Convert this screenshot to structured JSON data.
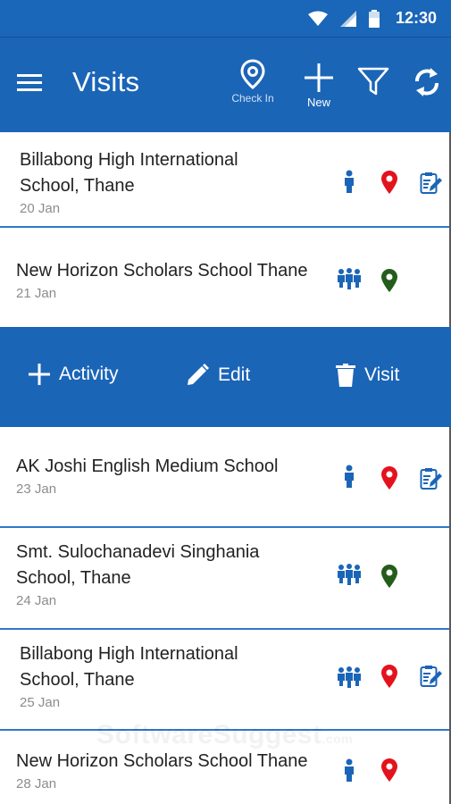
{
  "status_bar": {
    "time": "12:30"
  },
  "app_bar": {
    "title": "Visits",
    "checkin_label": "Check In",
    "new_label": "New"
  },
  "visits": [
    {
      "name_line1": "Billabong High International",
      "name_line2": "School, Thane",
      "date": "20 Jan",
      "contact_icon": "person-icon",
      "location_color": "#e3131e"
    },
    {
      "name_line1": "New Horizon Scholars School Thane",
      "name_line2": "",
      "date": "21 Jan",
      "contact_icon": "group-icon",
      "location_color": "#245c1c"
    },
    {
      "name_line1": "AK Joshi English Medium School",
      "name_line2": "",
      "date": "23 Jan",
      "contact_icon": "person-icon",
      "location_color": "#e3131e"
    },
    {
      "name_line1": "Smt. Sulochanadevi Singhania",
      "name_line2": "School, Thane",
      "date": "24 Jan",
      "contact_icon": "group-icon",
      "location_color": "#245c1c"
    },
    {
      "name_line1": "Billabong High International",
      "name_line2": "School, Thane",
      "date": "25 Jan",
      "contact_icon": "group-icon",
      "location_color": "#e3131e"
    },
    {
      "name_line1": "New Horizon Scholars School Thane",
      "name_line2": "",
      "date": "28 Jan",
      "contact_icon": "person-icon",
      "location_color": "#e3131e"
    }
  ],
  "row_actions": {
    "activity_label": "Activity",
    "edit_label": "Edit",
    "visit_label": "Visit"
  },
  "watermark": {
    "brand": "SoftwareSuggest",
    "suffix": ".com"
  },
  "colors": {
    "primary": "#1b65b7",
    "accent_line": "#2f78c8",
    "icon_blue": "#1b65b7"
  }
}
